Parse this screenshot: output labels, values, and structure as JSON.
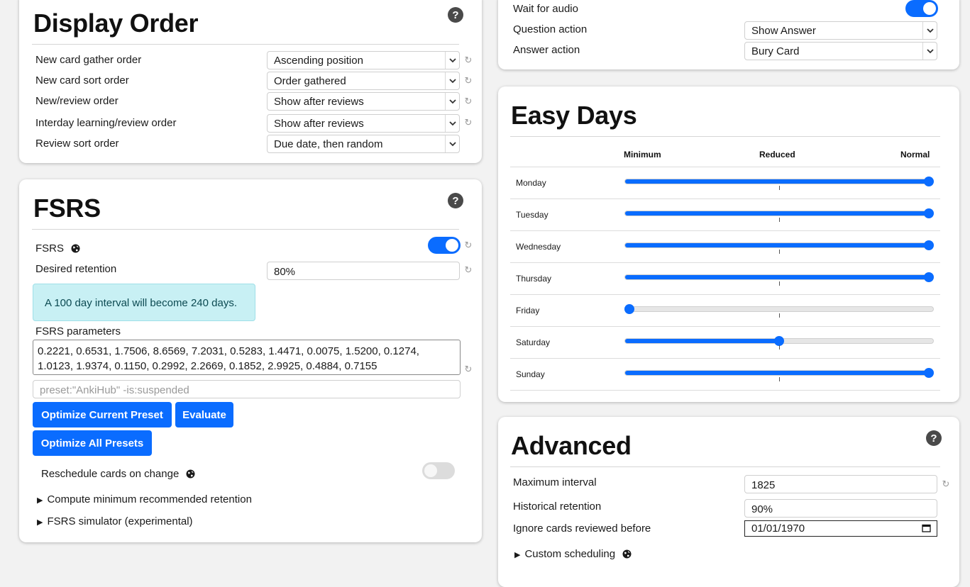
{
  "display_order": {
    "title": "Display Order",
    "rows": [
      {
        "label": "New card gather order",
        "value": "Ascending position"
      },
      {
        "label": "New card sort order",
        "value": "Order gathered"
      },
      {
        "label": "New/review order",
        "value": "Show after reviews"
      },
      {
        "label": "Interday learning/review order",
        "value": "Show after reviews"
      },
      {
        "label": "Review sort order",
        "value": "Due date, then random"
      }
    ]
  },
  "audio": {
    "wait_label": "Wait for audio",
    "question_label": "Question action",
    "question_value": "Show Answer",
    "answer_label": "Answer action",
    "answer_value": "Bury Card"
  },
  "fsrs": {
    "title": "FSRS",
    "toggle_label": "FSRS",
    "retention_label": "Desired retention",
    "retention_value": "80%",
    "info": "A 100 day interval will become 240 days.",
    "params_label": "FSRS parameters",
    "params_value": "0.2221, 0.6531, 1.7506, 8.6569, 7.2031, 0.5283, 1.4471, 0.0075, 1.5200, 0.1274, 1.0123, 1.9374, 0.1150, 0.2992, 2.2669, 0.1852, 2.9925, 0.4884, 0.7155",
    "search_placeholder": "preset:\"AnkiHub\" -is:suspended",
    "optimize_current": "Optimize Current Preset",
    "evaluate": "Evaluate",
    "optimize_all": "Optimize All Presets",
    "reschedule_label": "Reschedule cards on change",
    "compute_min": "Compute minimum recommended retention",
    "simulator": "FSRS simulator (experimental)"
  },
  "easy_days": {
    "title": "Easy Days",
    "columns": [
      "Minimum",
      "Reduced",
      "Normal"
    ],
    "days": [
      {
        "name": "Monday",
        "level": 1.0
      },
      {
        "name": "Tuesday",
        "level": 1.0
      },
      {
        "name": "Wednesday",
        "level": 1.0
      },
      {
        "name": "Thursday",
        "level": 1.0
      },
      {
        "name": "Friday",
        "level": 0.0
      },
      {
        "name": "Saturday",
        "level": 0.5
      },
      {
        "name": "Sunday",
        "level": 1.0
      }
    ]
  },
  "advanced": {
    "title": "Advanced",
    "max_interval_label": "Maximum interval",
    "max_interval_value": "1825",
    "hist_retention_label": "Historical retention",
    "hist_retention_value": "90%",
    "ignore_label": "Ignore cards reviewed before",
    "ignore_value": "01/01/1970",
    "custom_scheduling": "Custom scheduling"
  },
  "colors": {
    "accent": "#0a6cff",
    "info_bg": "#c8f0f4"
  }
}
